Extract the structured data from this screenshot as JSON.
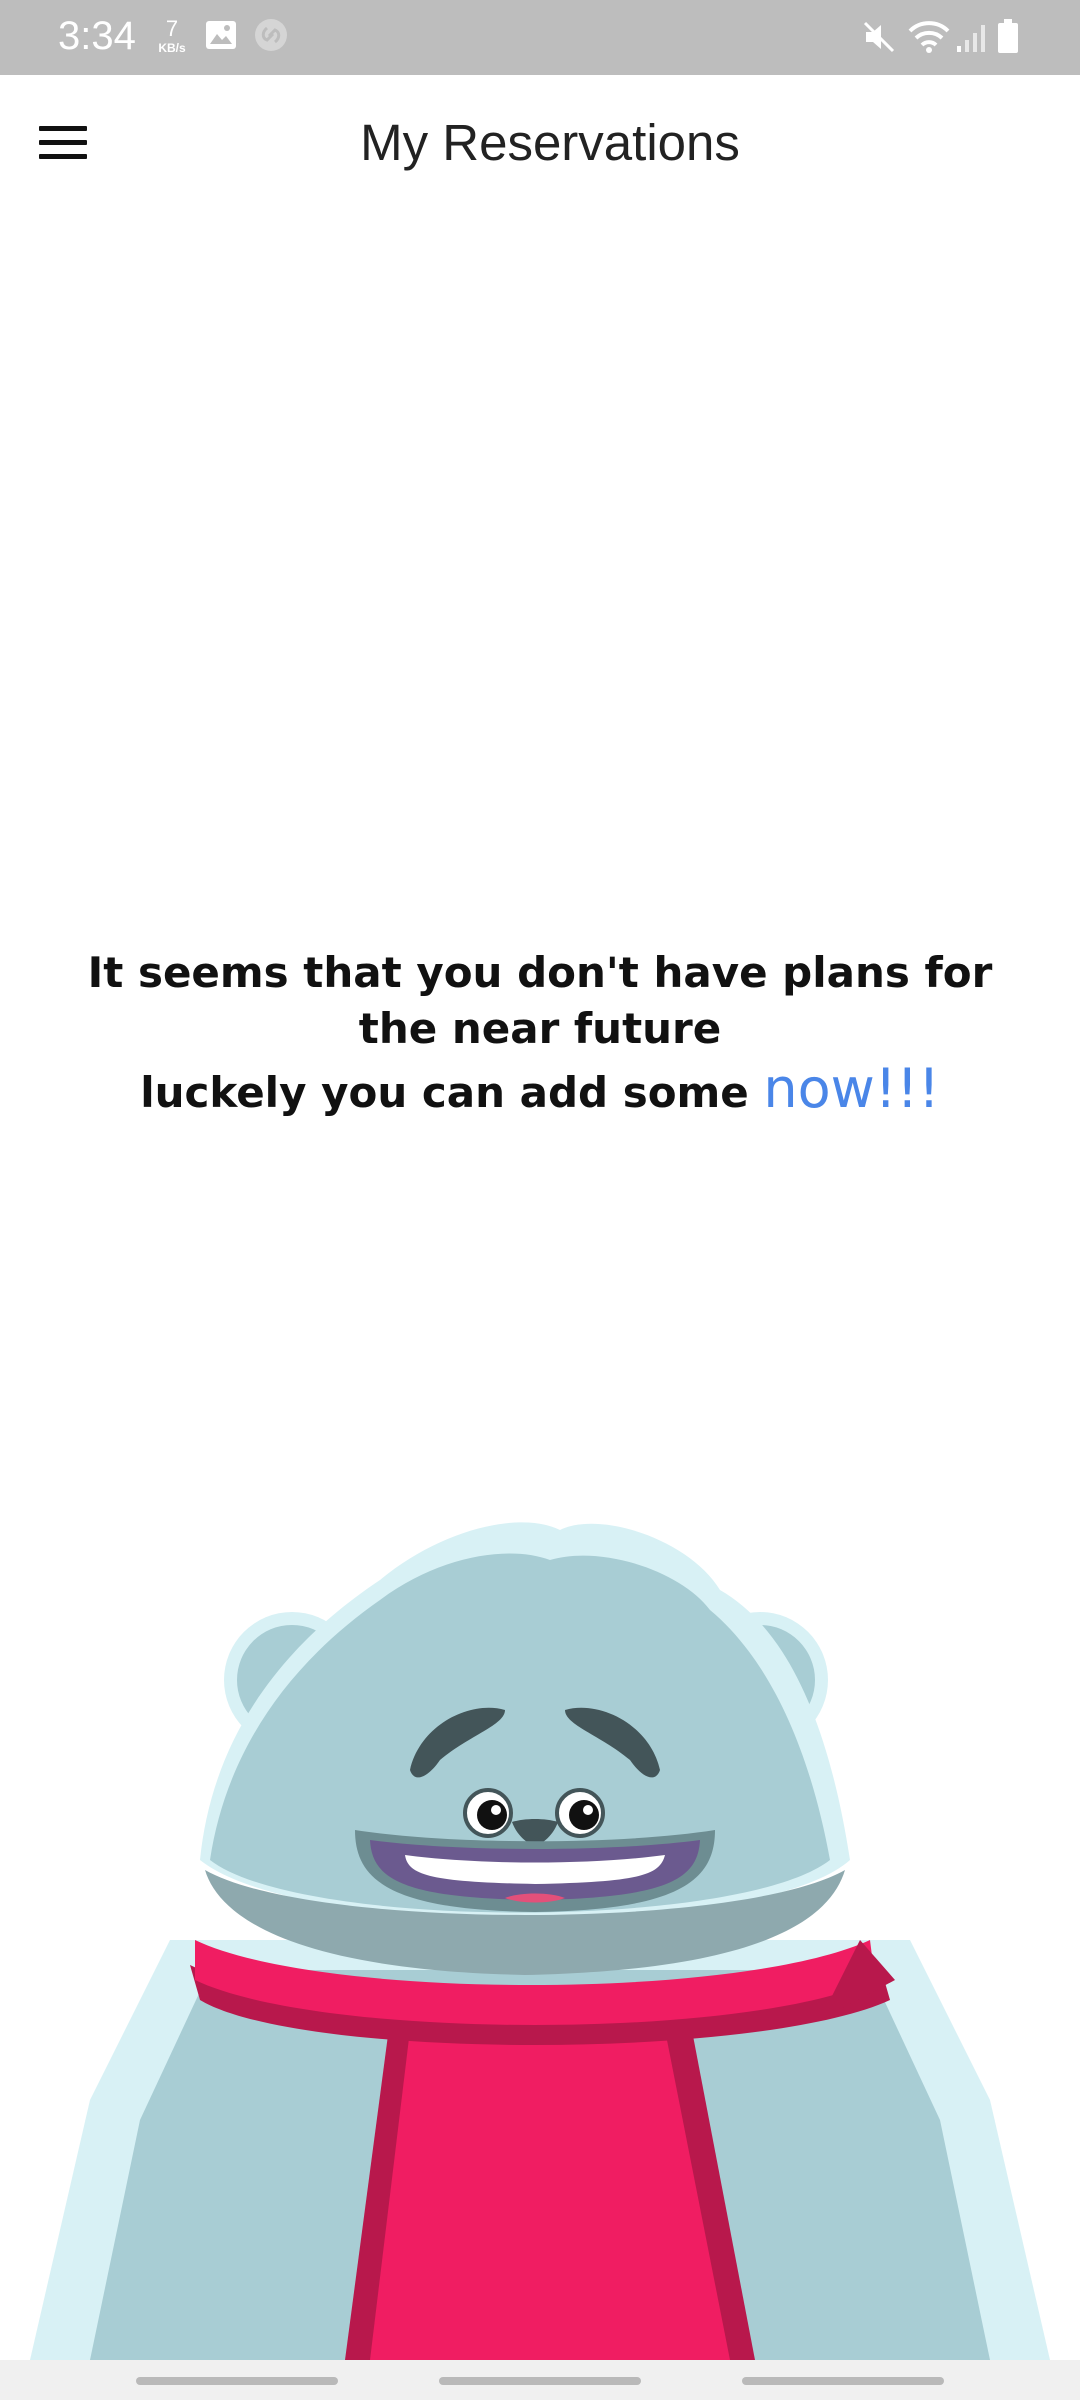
{
  "status_bar": {
    "time": "3:34",
    "speed_value": "7",
    "speed_unit": "KB/s",
    "icons": [
      "gallery-icon",
      "shazam-icon",
      "mute-icon",
      "wifi-icon",
      "signal-icon",
      "battery-icon"
    ]
  },
  "app_bar": {
    "menu_icon": "hamburger-menu-icon",
    "title": "My Reservations"
  },
  "empty_state": {
    "line1": "It seems that you don't have plans for the near future",
    "line2_prefix": "luckely you can add some ",
    "line2_link": "now!!!"
  },
  "illustration": {
    "name": "yeti-mascot",
    "colors": {
      "fur": "#a8cdd4",
      "fur_light": "#d8f1f5",
      "scarf": "#f01d62",
      "scarf_dark": "#b8184c",
      "ears_inner": "#9b5a96",
      "mouth": "#6b5a8f",
      "brows": "#435559"
    }
  },
  "colors": {
    "status_bar_bg": "#bdbdbd",
    "link": "#4a86e8",
    "text": "#111111"
  }
}
